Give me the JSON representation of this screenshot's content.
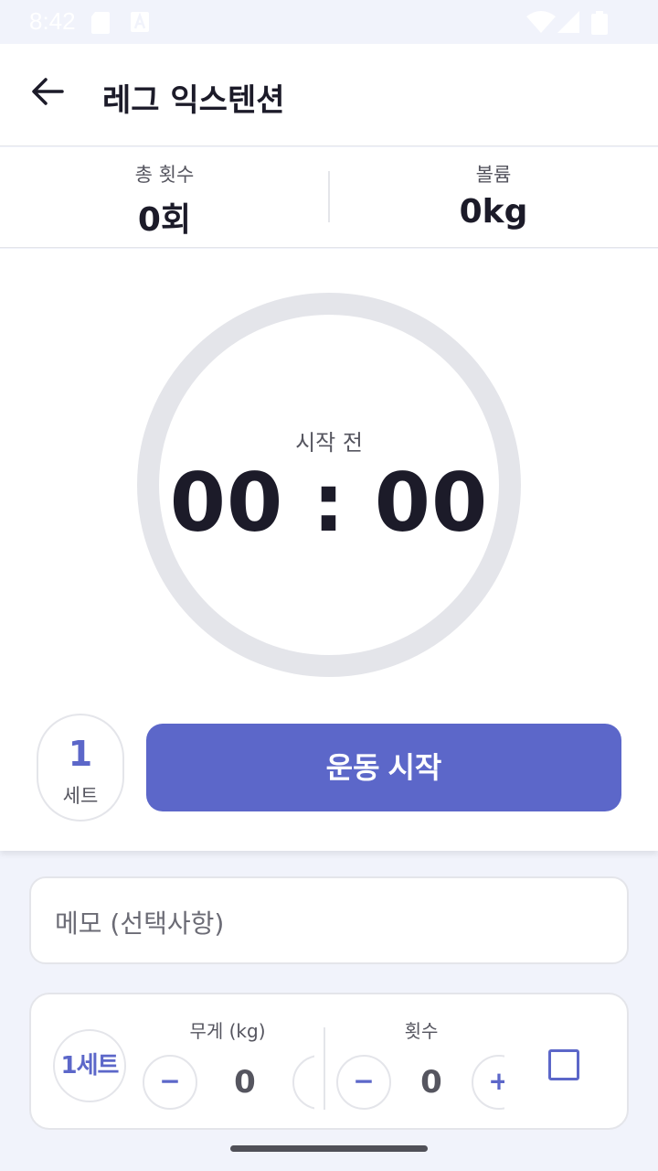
{
  "status_bar": {
    "time": "8:42"
  },
  "app_bar": {
    "title": "레그 익스텐션"
  },
  "stats": {
    "total_reps_label": "총 횟수",
    "total_reps_value": "0회",
    "volume_label": "볼륨",
    "volume_value": "0kg"
  },
  "timer": {
    "status": "시작 전",
    "time": "00 : 00"
  },
  "set_counter": {
    "number": "1",
    "label": "세트"
  },
  "start_button": {
    "label": "운동 시작"
  },
  "memo": {
    "placeholder": "메모 (선택사항)"
  },
  "set_row": {
    "badge": "1세트",
    "weight_label": "무게 (kg)",
    "weight_value": "0",
    "reps_label": "횟수",
    "reps_value": "0",
    "minus": "−",
    "plus": "+"
  },
  "colors": {
    "accent": "#5c67c9",
    "background": "#f1f3fb",
    "border": "#e4e5ea"
  }
}
